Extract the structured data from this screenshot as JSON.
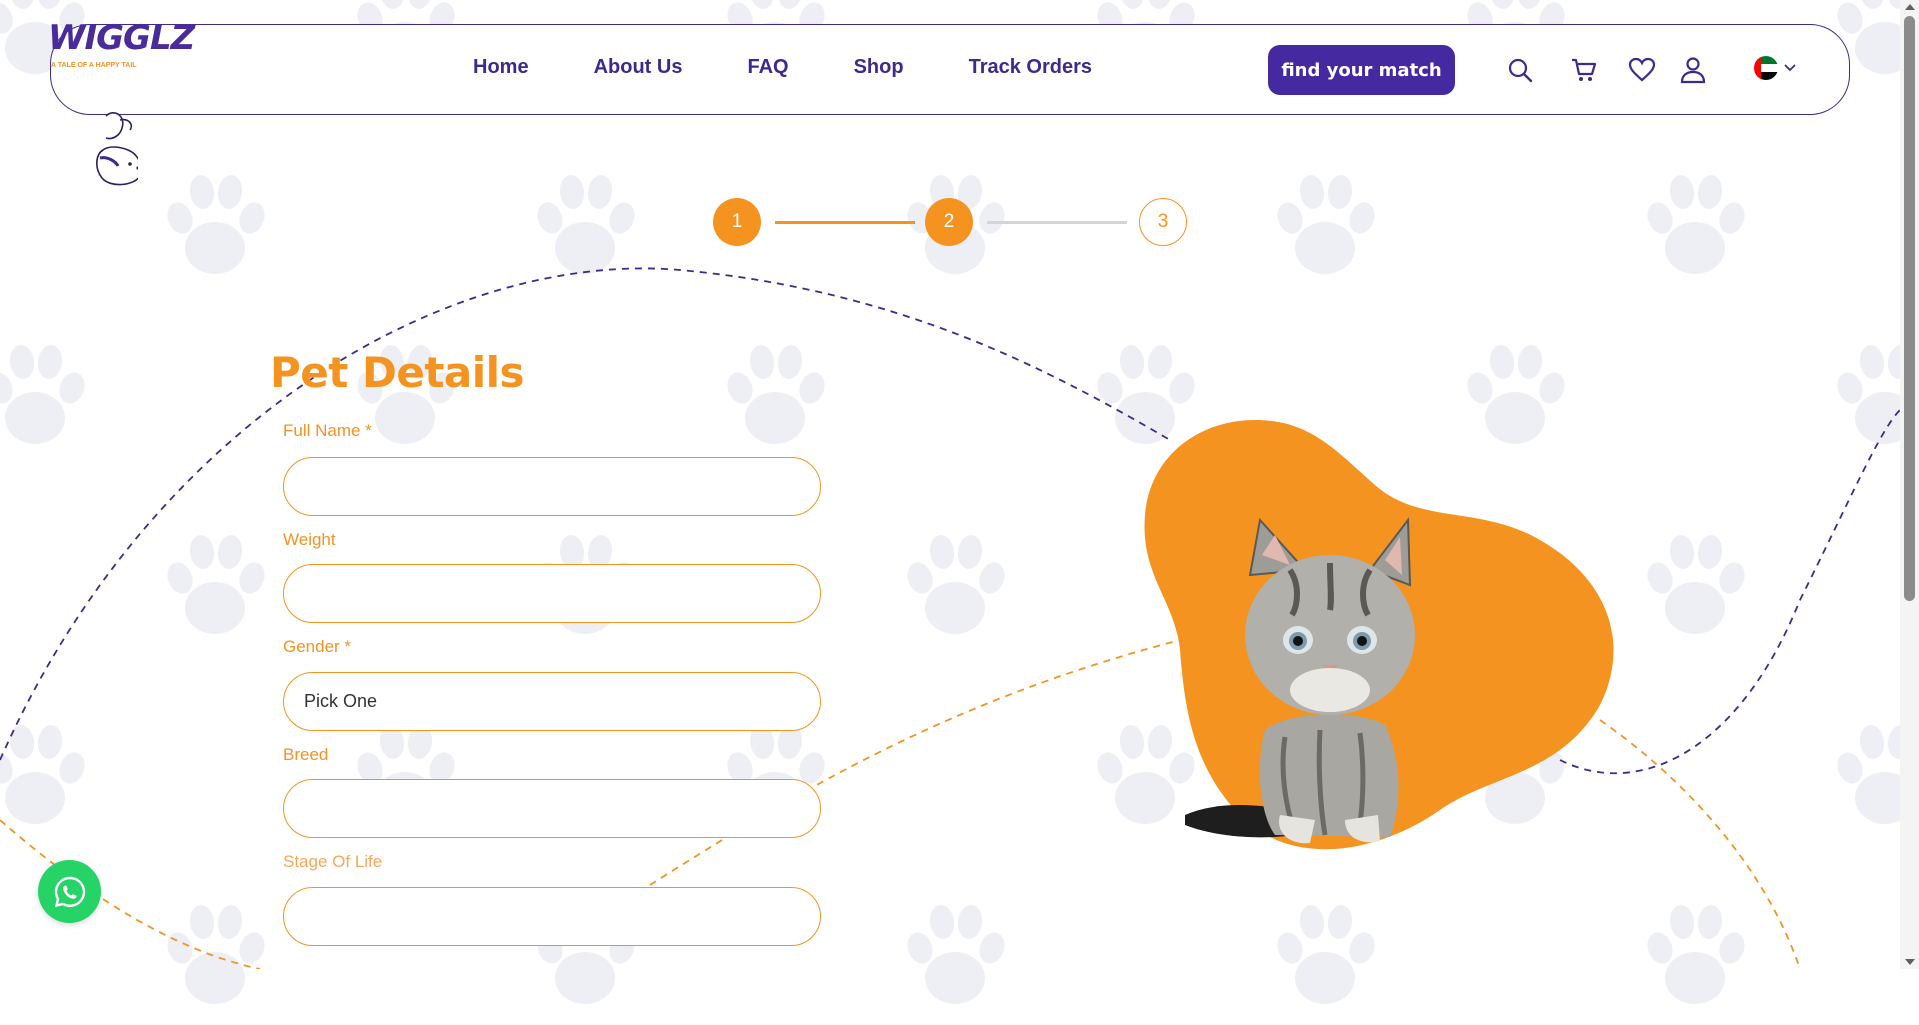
{
  "header": {
    "logo_text": "WIGGLZ",
    "logo_tagline": "A TALE OF A HAPPY TAIL",
    "nav": [
      "Home",
      "About Us",
      "FAQ",
      "Shop",
      "Track Orders"
    ],
    "cta_label": "find your match",
    "icons": [
      "search-icon",
      "cart-icon",
      "heart-icon",
      "user-icon"
    ],
    "language_flag": "uae-flag-icon"
  },
  "stepper": {
    "steps": [
      "1",
      "2",
      "3"
    ],
    "current": 2
  },
  "form": {
    "title": "Pet Details",
    "fields": {
      "full_name": {
        "label": "Full Name *",
        "value": ""
      },
      "weight": {
        "label": "Weight",
        "value": ""
      },
      "gender": {
        "label": "Gender *",
        "value": "Pick One"
      },
      "breed": {
        "label": "Breed",
        "value": ""
      },
      "stage_of_life": {
        "label": "Stage Of Life",
        "value": ""
      }
    }
  },
  "floating": {
    "icon": "whatsapp-icon"
  },
  "colors": {
    "primary_purple": "#4429a0",
    "accent_orange": "#f59320",
    "whatsapp_green": "#25d366"
  }
}
